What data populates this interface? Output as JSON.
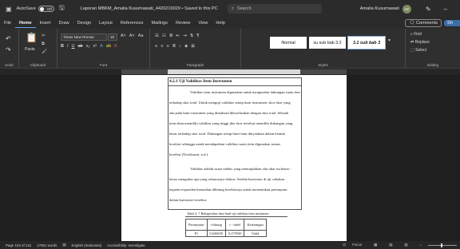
{
  "titlebar": {
    "autosave_label": "AutoSave",
    "autosave_state": "Off",
    "doc_title": "Laporan MBKM_Amalia Kusumawati_4420210029 • Saved to this PC",
    "search_placeholder": "Search",
    "user_name": "Amalia Kusumawati",
    "user_initials": "AK"
  },
  "tabs": [
    "File",
    "Home",
    "Insert",
    "Draw",
    "Design",
    "Layout",
    "References",
    "Mailings",
    "Review",
    "View",
    "Help"
  ],
  "tabs_right": {
    "comments_label": "Comments",
    "share_label": "Sh"
  },
  "ribbon": {
    "undo_label": "Undo",
    "clipboard_label": "Clipboard",
    "paste_label": "Paste",
    "font_label": "Font",
    "font_name": "Times New Roman",
    "font_size": "16",
    "paragraph_label": "Paragraph",
    "styles_label": "Styles",
    "styles": [
      "Normal",
      "su sub bab 3.2",
      "3.1 sub bab 3"
    ],
    "editing_label": "Editing",
    "find_label": "Find",
    "replace_label": "Replace",
    "select_label": "Select"
  },
  "document": {
    "heading": "4.2.1    Uji Validitas Item Instrumen",
    "lines": [
      "Validitas item instrumen digunakan untuk mengetahui dukungan suatu item",
      "terhadap skor total. Untuk menguji validitas setiap butir instrumen, skor-skor yang",
      "ada pada butir instrumen yang dimaksud dikorelasikan dengan skor total. Sebuah",
      "item akan memiliki validitas yang tinggi jika skor tersebut memiliki dukungan yang",
      "besar terhadap skor total. Dukungan setiap butir item dinyatakan dalam bentuk",
      "korelasi sehingga untuk mendapatkan validitas suatu item digunakan rumus",
      "korelasi (Novikasari, n.d.).",
      "Validitas adalah suatu indeks yang menunjukkan alat ukur itu benar -",
      "benar mengukur apa yang seharusnya diukur. Setelah kuesioner di uji cobakan",
      "kepada responden kemudian dihitung korelasinya untuk menentukan pertanyaan",
      "dalam kuesioner tersebut."
    ],
    "caption": "Tabel 4. 7 Rekapitulasi data hasil uji validitas item instrumen",
    "table_headers": [
      "Pertanyaan",
      "r-hitung",
      "r - tabel",
      "Keterangan"
    ],
    "table_rows": [
      [
        "P1",
        "0,626650",
        "0,275930",
        "Valid"
      ]
    ]
  },
  "statusbar": {
    "page_info": "Page 103 of 131",
    "word_count": "17551 words",
    "language": "English (Indonesia)",
    "accessibility": "Accessibility: Investigate",
    "focus_label": "Focus"
  }
}
